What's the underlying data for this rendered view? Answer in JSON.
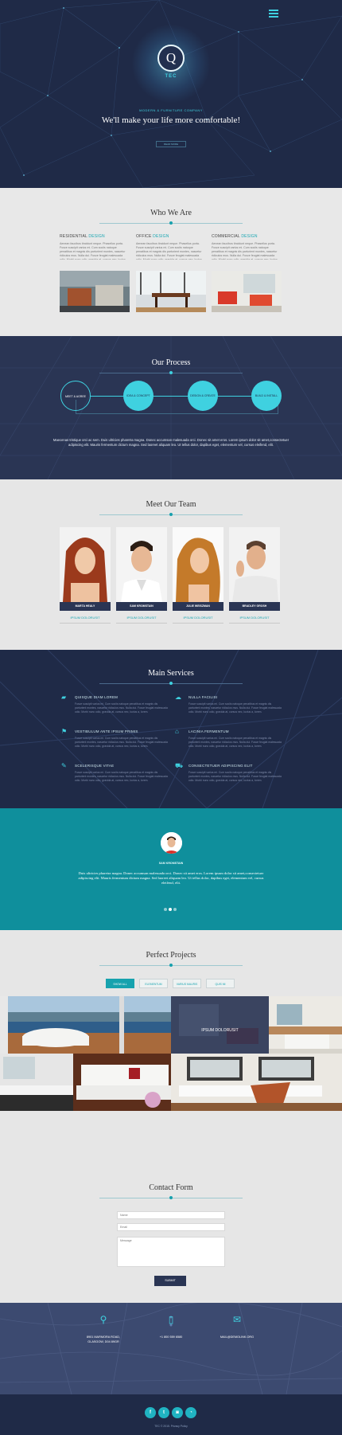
{
  "hero": {
    "logo_letter": "Q",
    "logo_text": "TEC",
    "eyebrow": "MODERN & FURNITURE COMPANY",
    "title": "We'll make your life more comfortable!",
    "button": "READ MORE"
  },
  "who": {
    "title": "Who We Are",
    "columns": [
      {
        "title": "RESIDENTIAL",
        "accent": "DESIGN",
        "text": "Aenean faucibus tincidunt neque. Phasellus porta. Fusce suscipit varius mi. Cum sociis natoque penatibus et magnis dis parturient montes, nascetur ridiculus mus. Nulla dui. Fusce feugiat malesuada odio. Morbi nunc odio, gravida at, cursus nec, luctus a, lorem."
      },
      {
        "title": "OFFICE",
        "accent": "DESIGN",
        "text": "Aenean faucibus tincidunt neque. Phasellus porta. Fusce suscipit varius mi. Cum sociis natoque penatibus et magnis dis parturient montes, nascetur ridiculus mus. Nulla dui. Fusce feugiat malesuada odio. Morbi nunc odio, gravida at, cursus nec, luctus a, lorem."
      },
      {
        "title": "COMMERCIAL",
        "accent": "DESIGN",
        "text": "Aenean faucibus tincidunt neque. Phasellus porta. Fusce suscipit varius mi. Cum sociis natoque penatibus et magnis dis parturient montes, nascetur ridiculus mus. Nulla dui. Fusce feugiat malesuada odio. Morbi nunc odio, gravida at, cursus nec, luctus a, lorem."
      }
    ]
  },
  "process": {
    "title": "Our Process",
    "steps": [
      "MEET & AGREE",
      "IDEA & CONCEPT",
      "DESIGN & CREATE",
      "BUILD & INSTALL"
    ],
    "text": "Maecenas tristique orci ac sem. Duis ultricies pharetra magna. Donec accumsan malesuada orci. Donec sit amet eros. Lorem ipsum dolor sit amet,consectetuer adipiscing elit. Mauris fermentum dictum magna. Sed laoreet aliquam leo. Ut tellus dolor, dapibus eget, elementum vel, cursus eleifend, elit."
  },
  "team": {
    "title": "Meet Our Team",
    "members": [
      {
        "name": "MARTA HEALY",
        "link": "IPSUM DOLORUSIT"
      },
      {
        "name": "SAM KROMSTAIN",
        "link": "IPSUM DOLORUSIT"
      },
      {
        "name": "JULIE WEISZMAN",
        "link": "IPSUM DOLORUSIT"
      },
      {
        "name": "BRADLEY GROSH",
        "link": "IPSUM DOLORUSIT"
      }
    ]
  },
  "services": {
    "title": "Main Services",
    "items": [
      {
        "icon": "sofa-icon",
        "glyph": "▰",
        "title": "QUISQUE DIAM LOREM",
        "text": "Fusce suscipit varius mi. Cum sociis natoque penatibus et magnis dis parturient montes, nascetur ridiculus mus. Nulla dui. Fusce feugiat malesuada odio. Morbi nunc odio, gravida at, cursus nec, luctus a, lorem."
      },
      {
        "icon": "cloud-icon",
        "glyph": "☁",
        "title": "NULLA FACILISI",
        "text": "Fusce suscipit varius mi. Cum sociis natoque penatibus et magnis dis parturient montes, nascetur ridiculus mus. Nulla dui. Fusce feugiat malesuada odio. Morbi nunc odio, gravida at, cursus nec, luctus a, lorem."
      },
      {
        "icon": "flag-icon",
        "glyph": "⚑",
        "title": "VESTIBULUM ANTE IPSUM PRIMIS",
        "text": "Fusce suscipit varius mi. Cum sociis natoque penatibus et magnis dis parturient montes, nascetur ridiculus mus. Nulla dui. Fusce feugiat malesuada odio. Morbi nunc odio, gravida at, cursus nec, luctus a, lorem."
      },
      {
        "icon": "home-icon",
        "glyph": "⌂",
        "title": "LACINIA FERMENTUM",
        "text": "Fusce suscipit varius mi. Cum sociis natoque penatibus et magnis dis parturient montes, nascetur ridiculus mus. Nulla dui. Fusce feugiat malesuada odio. Morbi nunc odio, gravida at, cursus nec, luctus a, lorem."
      },
      {
        "icon": "edit-icon",
        "glyph": "✎",
        "title": "SCELERISQUE VITAE",
        "text": "Fusce suscipit varius mi. Cum sociis natoque penatibus et magnis dis parturient montes, nascetur ridiculus mus. Nulla dui. Fusce feugiat malesuada odio. Morbi nunc odio, gravida at, cursus nec, luctus a, lorem."
      },
      {
        "icon": "truck-icon",
        "glyph": "⛟",
        "title": "CONSECTETUER ADIPISCING ELIT",
        "text": "Fusce suscipit varius mi. Cum sociis natoque penatibus et magnis dis parturient montes, nascetur ridiculus mus. Nulla dui. Fusce feugiat malesuada odio. Morbi nunc odio, gravida at, cursus nec, luctus a, lorem."
      }
    ]
  },
  "testimonial": {
    "name": "SAM KROMSTAIN",
    "quote": "Duis ultricies pharetra magna. Donec accumsan malesuada orci. Donec sit amet eros. Lorem ipsum dolor sit amet,consectetuer adipiscing elit. Mauris fermentum dictum magna. Sed laoreet aliquam leo. Ut tellus dolor, dapibus eget, elementum vel, cursus eleifend, elit."
  },
  "projects": {
    "title": "Perfect Projects",
    "filters": [
      "SHOW ALL",
      "ELEMENTUM",
      "VARIUS MAURIS",
      "QUIS MI"
    ],
    "caption": "IPSUM DOLORUSIT"
  },
  "contact": {
    "title": "Contact Form",
    "name_placeholder": "Name",
    "email_placeholder": "Email",
    "message_placeholder": "Message",
    "submit": "SUBMIT"
  },
  "footer_info": {
    "address_line1": "8901 MARMORA ROAD,",
    "address_line2": "GLASGOW, D04 89GR",
    "phone": "+1 800 559 6580",
    "email": "MAIL@DEMOLINK.ORG"
  },
  "footer": {
    "social": [
      {
        "name": "facebook-icon",
        "glyph": "f"
      },
      {
        "name": "twitter-icon",
        "glyph": "t"
      },
      {
        "name": "instagram-icon",
        "glyph": "◙"
      },
      {
        "name": "rss-icon",
        "glyph": "◔"
      }
    ],
    "copyright": "TEC © 2015. Privacy Policy"
  },
  "colors": {
    "accent": "#3fd1e0",
    "navy": "#1f2a47",
    "teal": "#0f8f9c"
  }
}
